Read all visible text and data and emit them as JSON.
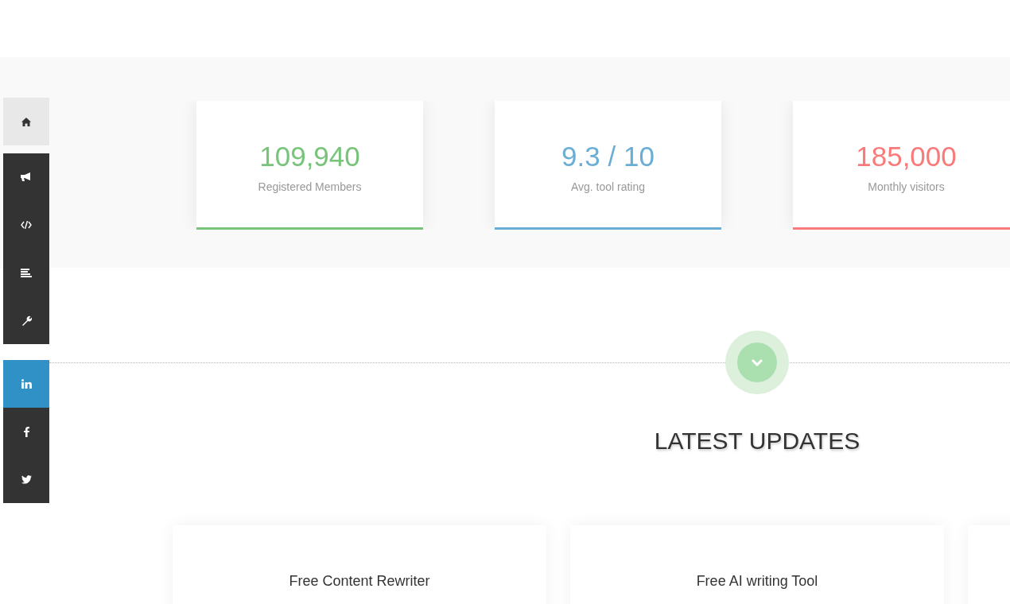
{
  "sidebar": {
    "nav_items": [
      {
        "kind": "home",
        "selected": true
      },
      {
        "kind": "megaphone",
        "selected": false
      },
      {
        "kind": "code",
        "selected": false
      },
      {
        "kind": "lines",
        "selected": false
      },
      {
        "kind": "wrench",
        "selected": false
      }
    ],
    "social_items": [
      {
        "kind": "linkedin",
        "color": "#2f91c6"
      },
      {
        "kind": "facebook",
        "color": "#333333"
      },
      {
        "kind": "twitter",
        "color": "#333333"
      }
    ]
  },
  "stats": [
    {
      "value": "109,940",
      "label": "Registered Members",
      "color": "#77c47a"
    },
    {
      "value": "9.3 / 10",
      "label": "Avg. tool rating",
      "color": "#6aaed6"
    },
    {
      "value": "185,000",
      "label": "Monthly visitors",
      "color": "#f97a7a"
    }
  ],
  "section_title": "LATEST UPDATES",
  "updates": [
    {
      "title": "Free Content Rewriter"
    },
    {
      "title": "Free AI writing Tool"
    }
  ]
}
